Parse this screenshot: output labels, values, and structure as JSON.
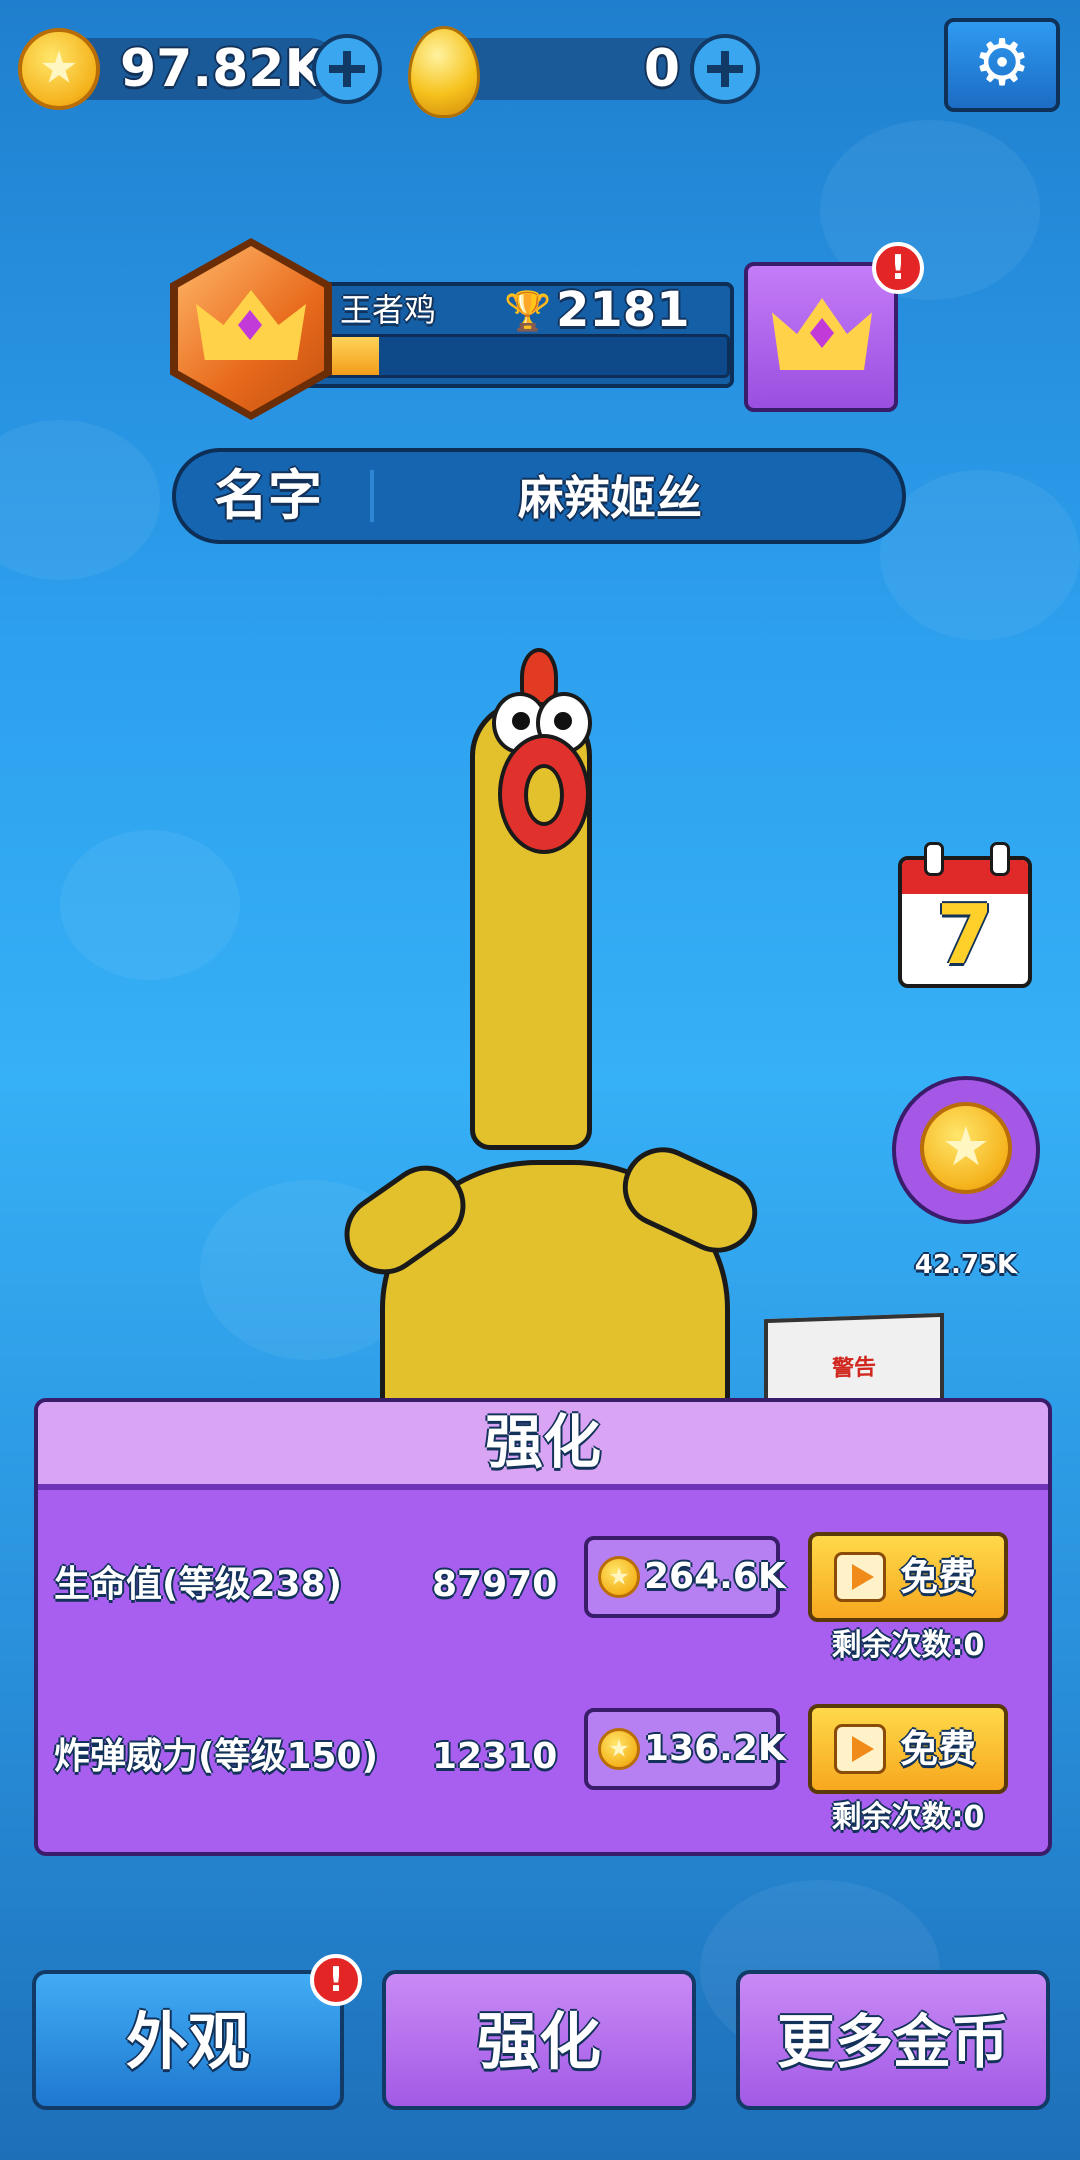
{
  "currency": {
    "coins_value": "97.82K",
    "eggs_value": "0"
  },
  "profile": {
    "rank_title": "王者鸡",
    "trophies": "2181",
    "rank_progress": 0.18
  },
  "name_field": {
    "label": "名字",
    "value": "麻辣姬丝"
  },
  "side": {
    "calendar_number": "7",
    "coin_reward_value": "42.75K"
  },
  "props": {
    "box_label": "警告"
  },
  "upgrade_panel": {
    "title": "强化",
    "rows": [
      {
        "label": "生命值(等级238)",
        "value": "87970",
        "cost": "264.6K",
        "free_label": "免费",
        "remaining": "剩余次数:0"
      },
      {
        "label": "炸弹威力(等级150)",
        "value": "12310",
        "cost": "136.2K",
        "free_label": "免费",
        "remaining": "剩余次数:0"
      }
    ]
  },
  "bottom_nav": {
    "appearance": "外观",
    "upgrade": "强化",
    "more_coins": "更多金币"
  },
  "alerts": {
    "mark": "!"
  },
  "colors": {
    "panel_purple": "#a85ff0",
    "panel_header": "#d9a4f4",
    "nav_blue": "#2f9af0",
    "nav_purple": "#b06cf0",
    "badge_red": "#e32526",
    "free_yellow": "#ffc83a"
  }
}
